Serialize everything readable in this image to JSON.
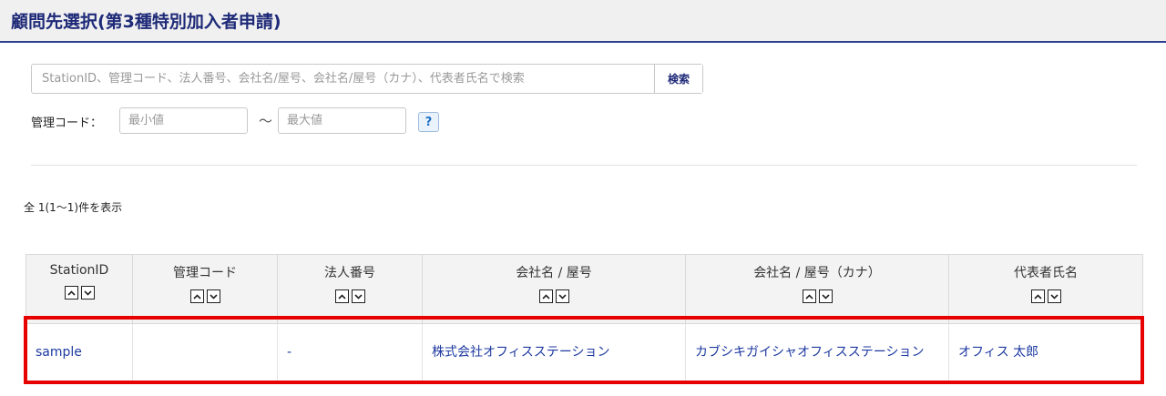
{
  "page": {
    "title": "顧問先選択(第3種特別加入者申請)"
  },
  "search": {
    "placeholder": "StationID、管理コード、法人番号、会社名/屋号、会社名/屋号（カナ）、代表者氏名で検索",
    "value": "",
    "button_label": "検索"
  },
  "code_filter": {
    "label": "管理コード：",
    "min_placeholder": "最小値",
    "max_placeholder": "最大値",
    "separator": "〜",
    "help_label": "?"
  },
  "results": {
    "count_text": "全 1(1〜1)件を表示",
    "columns": [
      {
        "label": "StationID"
      },
      {
        "label": "管理コード"
      },
      {
        "label": "法人番号"
      },
      {
        "label": "会社名 / 屋号"
      },
      {
        "label": "会社名 / 屋号（カナ）"
      },
      {
        "label": "代表者氏名"
      }
    ],
    "rows": [
      {
        "station_id": "sample",
        "management_code": "",
        "corporate_number": "-",
        "company_name": "株式会社オフィスステーション",
        "company_name_kana": "カブシキガイシャオフィスステーション",
        "representative": "オフィス 太郎"
      }
    ]
  },
  "icons": {
    "sort_asc": "chevron-up-icon",
    "sort_desc": "chevron-down-icon",
    "help": "question-icon"
  },
  "colors": {
    "title": "#1e2a78",
    "link": "#1e3aa0",
    "highlight": "#e60000",
    "header_rule": "#2d3f8e"
  }
}
